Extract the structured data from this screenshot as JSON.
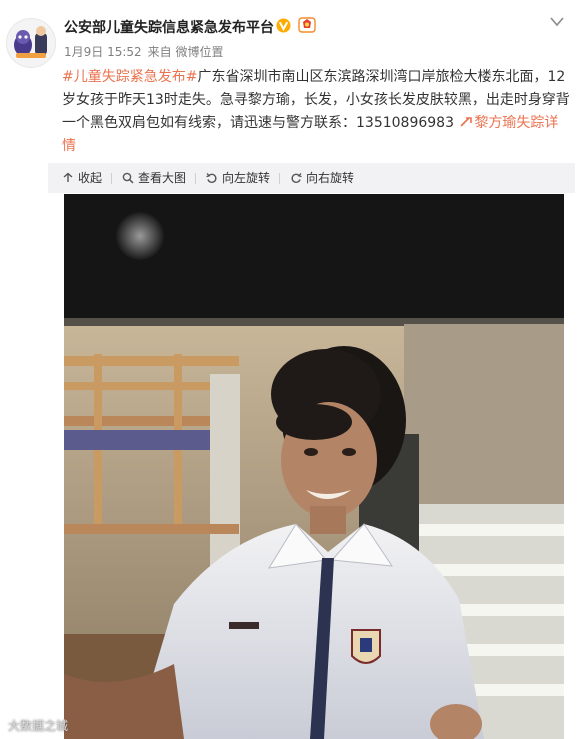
{
  "header": {
    "account_name": "公安部儿童失踪信息紧急发布平台",
    "date": "1月9日 15:52",
    "source": "来自 微博位置",
    "verified_icon": "verified-badge-icon",
    "badge_icon": "vip-badge-icon",
    "menu_icon": "chevron-down-icon"
  },
  "post": {
    "topic": "#儿童失踪紧急发布#",
    "body": "广东省深圳市南山区东滨路深圳湾口岸旅检大楼东北面，12岁女孩于昨天13时走失。急寻黎方瑜，长发，小女孩长发皮肤较黑，出走时身穿背一个黑色双肩包如有线索，请迅速与警方联系：13510896983",
    "link_text": "黎方瑜失踪详情",
    "link_icon": "location-pin-icon"
  },
  "toolbar": {
    "collapse": "收起",
    "view_large": "查看大图",
    "rotate_left": "向左旋转",
    "rotate_right": "向右旋转"
  },
  "image": {
    "watermark": "大数据之城"
  },
  "colors": {
    "link": "#eb7350",
    "verified": "#ffab00",
    "toolbar_bg": "#f2f2f5"
  }
}
